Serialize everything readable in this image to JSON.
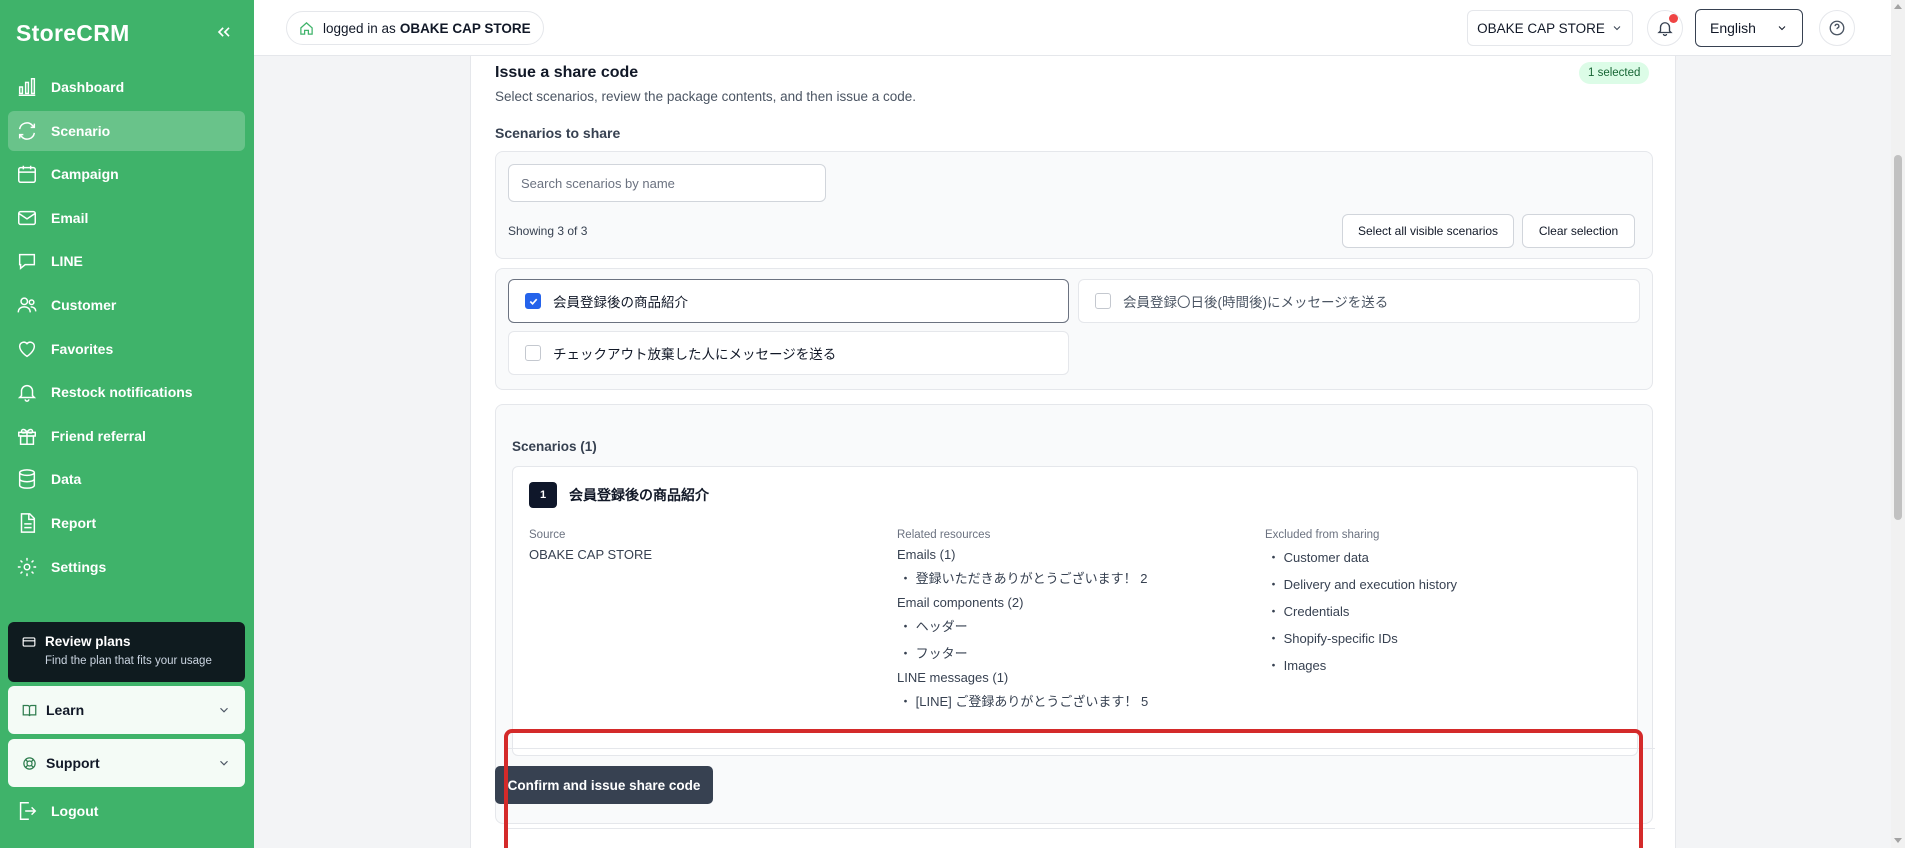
{
  "app": {
    "brand": "StoreCRM"
  },
  "sidebar": {
    "items": [
      {
        "label": "Dashboard",
        "icon": "bar-chart-icon",
        "active": false
      },
      {
        "label": "Scenario",
        "icon": "refresh-icon",
        "active": true
      },
      {
        "label": "Campaign",
        "icon": "calendar-icon",
        "active": false
      },
      {
        "label": "Email",
        "icon": "mail-icon",
        "active": false
      },
      {
        "label": "LINE",
        "icon": "chat-icon",
        "active": false
      },
      {
        "label": "Customer",
        "icon": "users-icon",
        "active": false
      },
      {
        "label": "Favorites",
        "icon": "heart-icon",
        "active": false
      },
      {
        "label": "Restock notifications",
        "icon": "bell-icon",
        "active": false
      },
      {
        "label": "Friend referral",
        "icon": "gift-icon",
        "active": false
      },
      {
        "label": "Data",
        "icon": "database-icon",
        "active": false
      },
      {
        "label": "Report",
        "icon": "file-icon",
        "active": false
      },
      {
        "label": "Settings",
        "icon": "gear-icon",
        "active": false
      }
    ],
    "promo": {
      "title": "Review plans",
      "subtitle": "Find the plan that fits your usage"
    },
    "learn_label": "Learn",
    "support_label": "Support",
    "logout_label": "Logout"
  },
  "topbar": {
    "login_prefix": "logged in as",
    "login_store": "OBAKE CAP STORE",
    "store_select": "OBAKE CAP STORE",
    "language": "English"
  },
  "share": {
    "title": "Issue a share code",
    "description": "Select scenarios, review the package contents, and then issue a code.",
    "selected_badge": "1 selected",
    "section_label": "Scenarios to share",
    "search_placeholder": "Search scenarios by name",
    "showing": "Showing 3 of 3",
    "select_all_label": "Select all visible scenarios",
    "clear_label": "Clear selection",
    "options": [
      {
        "label": "会員登録後の商品紹介",
        "checked": true
      },
      {
        "label": "会員登録〇日後(時間後)にメッセージを送る",
        "checked": false
      },
      {
        "label": "チェックアウト放棄した人にメッセージを送る",
        "checked": false
      }
    ],
    "review": {
      "count_label": "Scenarios (1)",
      "index": "1",
      "name": "会員登録後の商品紹介",
      "source_head": "Source",
      "source_value": "OBAKE CAP STORE",
      "related_head": "Related resources",
      "emails_group": "Emails (1)",
      "emails": [
        "登録いただきありがとうございます！ 2"
      ],
      "components_group": "Email components (2)",
      "components": [
        "ヘッダー",
        "フッター"
      ],
      "line_group": "LINE messages (1)",
      "line_messages": [
        "[LINE] ご登録ありがとうございます！ 5"
      ],
      "excluded_head": "Excluded from sharing",
      "excluded": [
        "Customer data",
        "Delivery and execution history",
        "Credentials",
        "Shopify-specific IDs",
        "Images"
      ]
    },
    "confirm_label": "Confirm and issue share code"
  },
  "colors": {
    "sidebar": "#3fb36a",
    "highlight": "#d42a2a",
    "checkbox": "#2563eb"
  }
}
